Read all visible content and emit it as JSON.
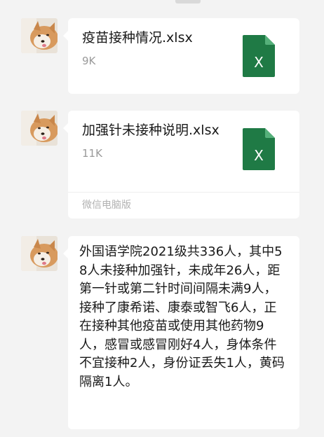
{
  "chat": {
    "messages": [
      {
        "type": "file",
        "file_name": "疫苗接种情况.xlsx",
        "file_size": "9K",
        "file_icon": "excel-file-icon",
        "icon_letter": "X"
      },
      {
        "type": "file",
        "file_name": "加强针未接种说明.xlsx",
        "file_size": "11K",
        "file_icon": "excel-file-icon",
        "icon_letter": "X",
        "source": "微信电脑版"
      },
      {
        "type": "text",
        "text": "外国语学院2021级共336人，其中58人未接种加强针，未成年26人，距第一针或第二针时间间隔未满9人，接种了康希诺、康泰或智飞6人，正在接种其他疫苗或使用其他药物9人，感冒或感冒刚好4人，身体条件不宜接种2人，身份证丢失1人，黄码隔离1人。"
      }
    ]
  },
  "colors": {
    "background": "#f3f3f3",
    "bubble": "#ffffff",
    "excel_green": "#1f7a45",
    "excel_fold": "#55b07a",
    "secondary_text": "#9a9a9a"
  }
}
